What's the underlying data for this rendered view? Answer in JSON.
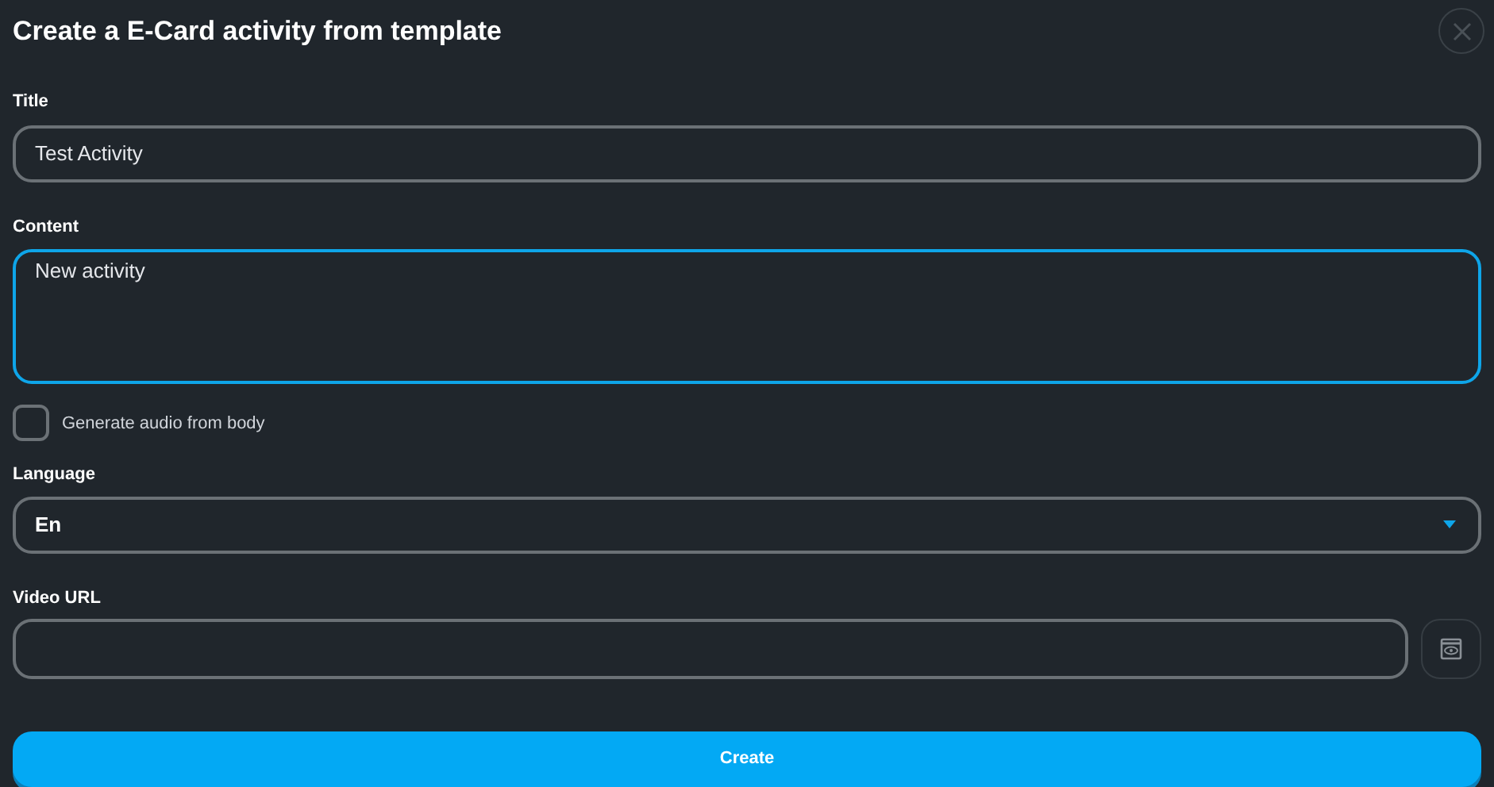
{
  "dialog": {
    "title": "Create a E-Card activity from template"
  },
  "title_field": {
    "label": "Title",
    "value": "Test Activity",
    "focused": false
  },
  "content_field": {
    "label": "Content",
    "value": "New activity",
    "focused": true
  },
  "audio_checkbox": {
    "label": "Generate audio from body",
    "checked": false
  },
  "language_field": {
    "label": "Language",
    "value": "En"
  },
  "video_field": {
    "label": "Video URL"
  },
  "create_button": {
    "label": "Create"
  }
}
